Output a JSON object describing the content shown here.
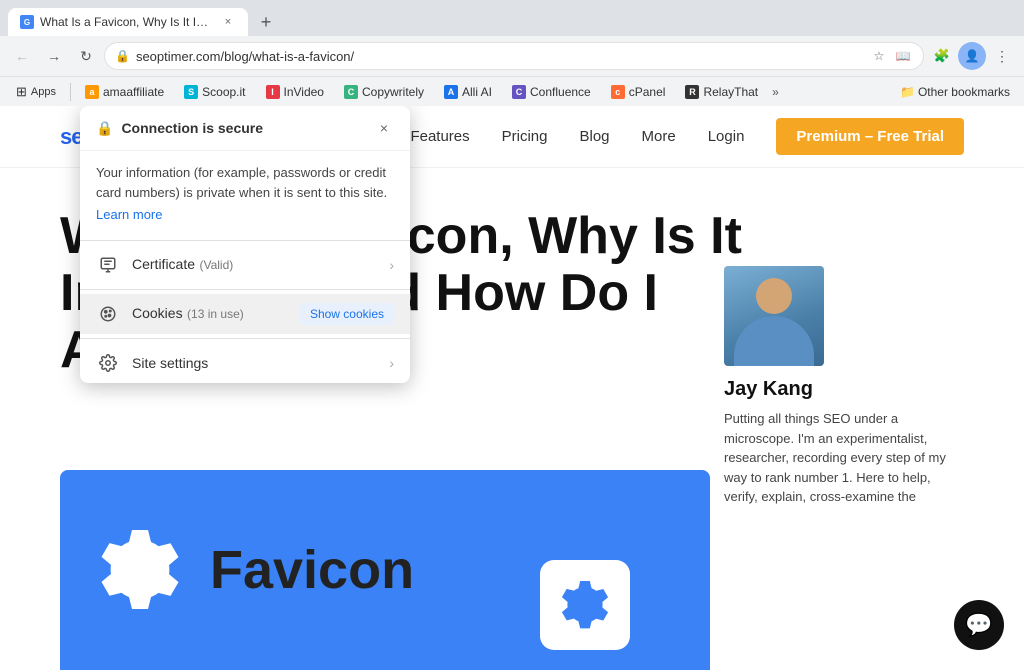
{
  "browser": {
    "tab": {
      "title": "What Is a Favicon, Why Is It Imp...",
      "favicon": "G",
      "close": "×"
    },
    "new_tab_btn": "+",
    "nav": {
      "back": "←",
      "forward": "→",
      "refresh": "↻",
      "home": "⌂",
      "url": "seoptimer.com/blog/what-is-a-favicon/",
      "url_full": "https://seoptimer.com/blog/what-is-a-favicon/"
    },
    "bookmarks": [
      {
        "id": "apps",
        "label": "Apps",
        "type": "apps"
      },
      {
        "id": "amaaffiliate",
        "label": "amaaffiliate",
        "color": "#ff9900",
        "letter": "a"
      },
      {
        "id": "scoopit",
        "label": "Scoop.it",
        "color": "#00b4d8",
        "letter": "S"
      },
      {
        "id": "invideo",
        "label": "InVideo",
        "color": "#e63946",
        "letter": "I"
      },
      {
        "id": "copywritely",
        "label": "Copywritely",
        "color": "#36b37e",
        "letter": "C"
      },
      {
        "id": "alliai",
        "label": "Alli AI",
        "color": "#1a73e8",
        "letter": "A"
      },
      {
        "id": "confluence",
        "label": "Confluence",
        "color": "#6554c0",
        "letter": "C"
      },
      {
        "id": "cpanel",
        "label": "cPanel",
        "color": "#ff6b35",
        "letter": "c"
      },
      {
        "id": "relaythat",
        "label": "RelayThat",
        "color": "#333",
        "letter": "R"
      },
      {
        "id": "other",
        "label": "Other bookmarks",
        "type": "folder"
      }
    ]
  },
  "popup": {
    "title": "Connection is secure",
    "close": "×",
    "description": "Your information (for example, passwords or credit card numbers) is private when it is sent to this site.",
    "learn_more": "Learn more",
    "items": [
      {
        "id": "certificate",
        "icon": "cert",
        "label": "Certificate",
        "sub": "(Valid)",
        "action": null
      },
      {
        "id": "cookies",
        "icon": "cookie",
        "label": "Cookies",
        "sub": "(13 in use)",
        "action": "Show cookies"
      },
      {
        "id": "site-settings",
        "icon": "gear",
        "label": "Site settings",
        "sub": null,
        "action": null
      }
    ]
  },
  "website": {
    "nav": {
      "logo_text": "seoptimer",
      "links": [
        {
          "id": "features",
          "label": "Features"
        },
        {
          "id": "pricing",
          "label": "Pricing"
        },
        {
          "id": "blog",
          "label": "Blog"
        },
        {
          "id": "more",
          "label": "More"
        },
        {
          "id": "login",
          "label": "Login"
        }
      ],
      "cta": "Premium – Free Trial"
    },
    "hero": {
      "title_line1": "What Is a",
      "title_line2": "Favicon, Why Is",
      "title_line3": "It Important, and How Do I",
      "title_line4": "Add One?"
    },
    "favicon_section": {
      "label": "Favicon"
    },
    "author": {
      "name": "Jay Kang",
      "bio": "Putting all things SEO under a microscope. I'm an experimentalist, researcher, recording every step of my way to rank number 1. Here to help, verify, explain, cross-examine the"
    },
    "chat": {
      "icon": "💬"
    }
  }
}
